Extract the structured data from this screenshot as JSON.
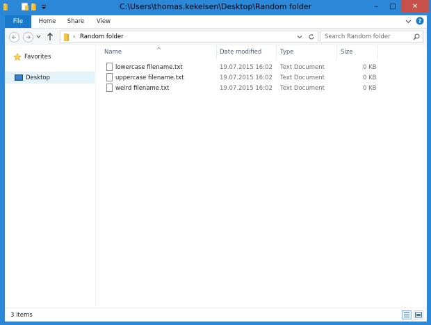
{
  "window": {
    "title": "C:\\Users\\thomas.kekeisen\\Desktop\\Random folder",
    "controls": {
      "minimize": "–",
      "maximize": "□",
      "close": "✕"
    }
  },
  "ribbon": {
    "tabs": [
      {
        "label": "File"
      },
      {
        "label": "Home"
      },
      {
        "label": "Share"
      },
      {
        "label": "View"
      }
    ]
  },
  "address_bar": {
    "crumbs": [
      "Random folder"
    ],
    "search_placeholder": "Search Random folder"
  },
  "navigation_pane": {
    "items": [
      {
        "label": "Favorites",
        "icon": "star-icon"
      },
      {
        "label": "Desktop",
        "icon": "desktop-icon",
        "selected": true
      }
    ]
  },
  "file_list": {
    "columns": [
      "Name",
      "Date modified",
      "Type",
      "Size"
    ],
    "rows": [
      {
        "name": "lowercase filename.txt",
        "date": "19.07.2015 16:02",
        "type": "Text Document",
        "size": "0 KB"
      },
      {
        "name": "uppercase filename.txt",
        "date": "19.07.2015 16:02",
        "type": "Text Document",
        "size": "0 KB"
      },
      {
        "name": "weird filename.txt",
        "date": "19.07.2015 16:02",
        "type": "Text Document",
        "size": "0 KB"
      }
    ]
  },
  "status_bar": {
    "item_count": "3 items"
  },
  "colors": {
    "chrome": "#2b88d9",
    "file_tab": "#1979ca",
    "close_button": "#c7504a",
    "selection": "#e5f3fb"
  }
}
